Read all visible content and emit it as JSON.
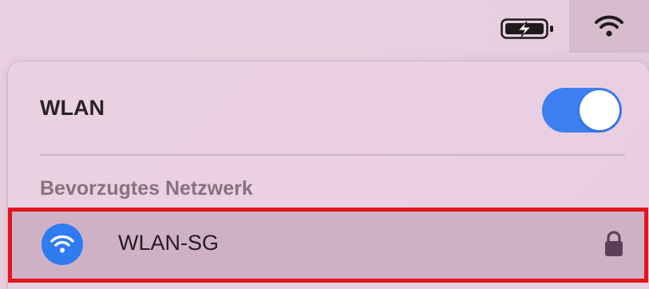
{
  "menubar": {
    "battery_icon": "battery-charging-icon",
    "wifi_icon": "wifi-icon"
  },
  "panel": {
    "title": "WLAN",
    "toggle": {
      "state": "on",
      "color": "#3b7ff1"
    },
    "section_title": "Bevorzugtes Netzwerk",
    "networks": [
      {
        "name": "WLAN-SG",
        "icon": "wifi-icon",
        "secured": true,
        "lock_icon": "lock-icon",
        "icon_color": "#2f7bf1"
      }
    ]
  },
  "highlight": {
    "color": "#e3141c"
  }
}
